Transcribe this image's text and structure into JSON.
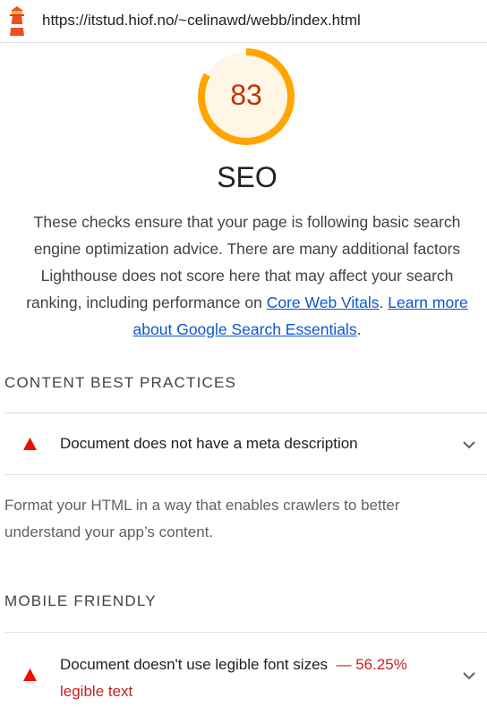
{
  "browser": {
    "url": "https://itstud.hiof.no/~celinawd/webb/index.html",
    "logo_icon": "lighthouse-icon"
  },
  "gauge": {
    "score": "83",
    "color": "#ffa400",
    "fill_fraction": 0.83
  },
  "category": {
    "title": "SEO",
    "description_part1": "These checks ensure that your page is following basic search engine optimization advice. There are many additional factors Lighthouse does not score here that may affect your search ranking, including performance on ",
    "link1": "Core Web Vitals",
    "description_part2": ". ",
    "link2": "Learn more about Google Search Essentials",
    "description_part3": "."
  },
  "groups": [
    {
      "header": "CONTENT BEST PRACTICES",
      "audits": [
        {
          "title": "Document does not have a meta description",
          "icon": "warning-triangle-icon"
        }
      ],
      "description": "Format your HTML in a way that enables crawlers to better understand your app’s content."
    },
    {
      "header": "MOBILE FRIENDLY",
      "audits": [
        {
          "title": "Document doesn't use legible font sizes",
          "display_value": "— 56.25% legible text",
          "icon": "warning-triangle-icon"
        }
      ]
    }
  ],
  "colors": {
    "fail": "#eb0f00",
    "link": "#0b57d0",
    "gauge_bg": "#fff6e6"
  }
}
